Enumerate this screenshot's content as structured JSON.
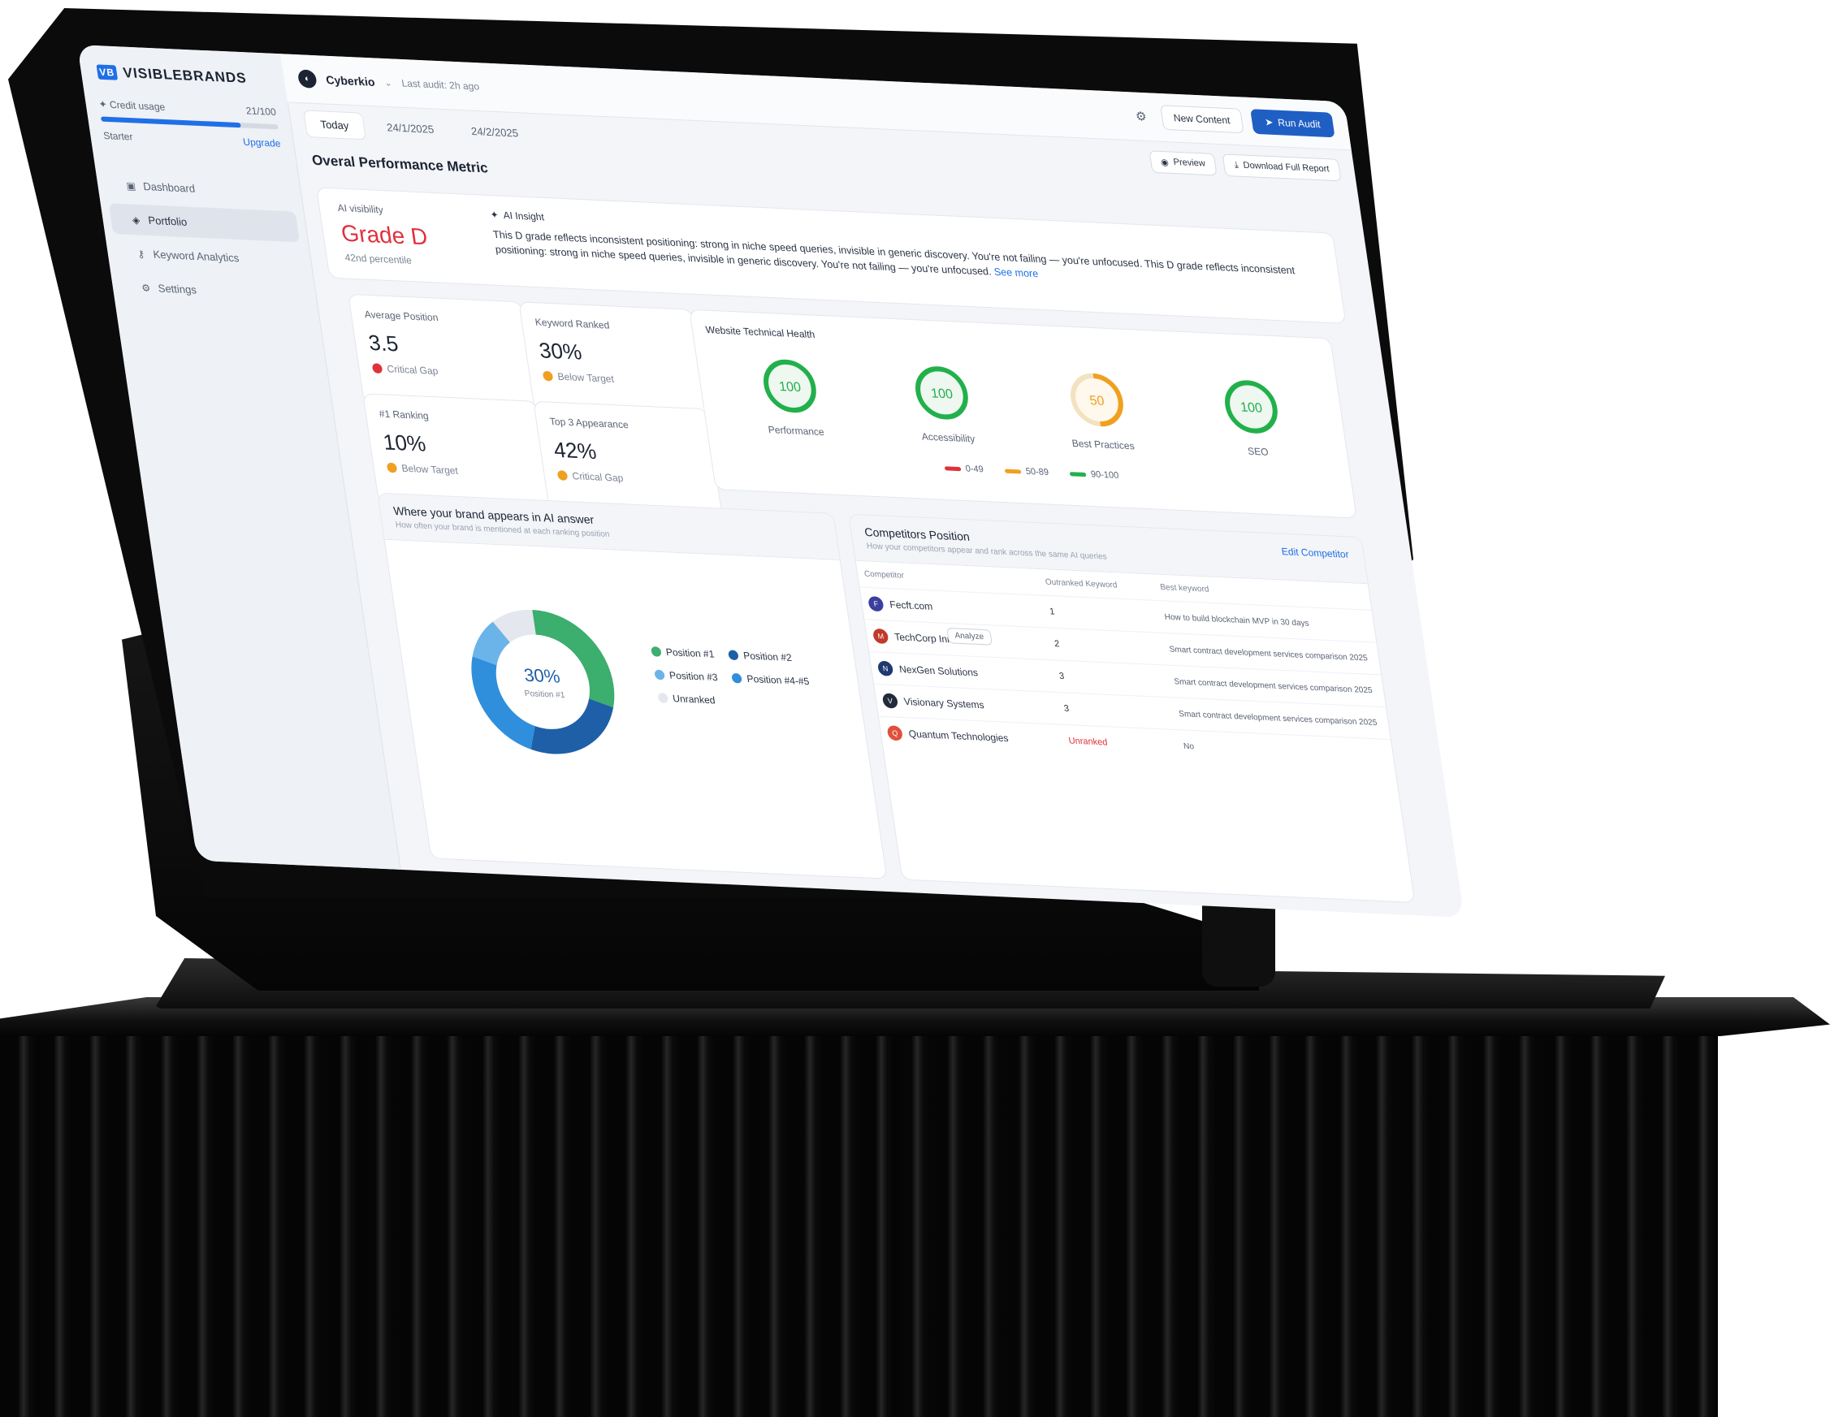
{
  "app": {
    "logo_text": "VISIBLEBRANDS",
    "logo_mark": "VB"
  },
  "sidebar": {
    "credit_label": "Credit usage",
    "credit_value": "21/100",
    "credit_fraction": 0.79,
    "plan": "Starter",
    "upgrade_label": "Upgrade",
    "items": [
      {
        "label": "Dashboard",
        "icon": "dashboard-icon",
        "active": false
      },
      {
        "label": "Portfolio",
        "icon": "portfolio-icon",
        "active": true
      },
      {
        "label": "Keyword Analytics",
        "icon": "key-icon",
        "active": false
      },
      {
        "label": "Settings",
        "icon": "gear-icon",
        "active": false
      }
    ]
  },
  "topbar": {
    "brand_name": "Cyberkio",
    "last_audit": "Last audit: 2h ago",
    "new_content_label": "New Content",
    "run_audit_label": "Run Audit"
  },
  "datebar": {
    "tabs": [
      "Today",
      "24/1/2025",
      "24/2/2025"
    ],
    "active_tab": "Today",
    "preview_label": "Preview",
    "download_label": "Download Full Report"
  },
  "main": {
    "section_title": "Overal Performance Metric",
    "ai_visibility": {
      "label": "AI visibility",
      "grade": "Grade D",
      "percentile": "42nd percentile"
    },
    "ai_insight": {
      "label": "AI Insight",
      "text": "This D grade reflects inconsistent positioning: strong in niche speed queries, invisible in generic discovery. You're not failing — you're unfocused. This D grade reflects inconsistent positioning: strong in niche speed queries, invisible in generic discovery. You're not failing — you're unfocused.",
      "see_more": "See more"
    },
    "metrics": [
      {
        "label": "Average Position",
        "value": "3.5",
        "status": "Critical Gap",
        "status_color": "#e0313b"
      },
      {
        "label": "Keyword Ranked",
        "value": "30%",
        "status": "Below Target",
        "status_color": "#f0a020"
      },
      {
        "label": "#1 Ranking",
        "value": "10%",
        "status": "Below Target",
        "status_color": "#f0a020"
      },
      {
        "label": "Top 3 Appearance",
        "value": "42%",
        "status": "Critical Gap",
        "status_color": "#f0a020"
      }
    ],
    "technical_health": {
      "title": "Website Technical Health",
      "gauges": [
        {
          "label": "Performance",
          "value": "100",
          "color": "#22b04b"
        },
        {
          "label": "Accessibility",
          "value": "100",
          "color": "#22b04b"
        },
        {
          "label": "Best Practices",
          "value": "50",
          "color": "#f0a020"
        },
        {
          "label": "SEO",
          "value": "100",
          "color": "#22b04b"
        }
      ],
      "legend": [
        {
          "label": "0-49",
          "color": "#e0313b"
        },
        {
          "label": "50-89",
          "color": "#f0a020"
        },
        {
          "label": "90-100",
          "color": "#22b04b"
        }
      ]
    },
    "brand_appearance": {
      "title": "Where your brand appears in AI answer",
      "subtitle": "How often your brand is mentioned at each ranking position",
      "center_value": "30%",
      "center_label": "Position #1",
      "legend": [
        {
          "label": "Position #1",
          "color": "#3cae6e"
        },
        {
          "label": "Position #2",
          "color": "#1f5fa8"
        },
        {
          "label": "Position #3",
          "color": "#6bb4ea"
        },
        {
          "label": "Position #4-#5",
          "color": "#2f8fdc"
        },
        {
          "label": "Unranked",
          "color": "#e4e8ee"
        }
      ]
    },
    "competitors": {
      "title": "Competitors Position",
      "subtitle": "How your competitors appear and rank across the same AI queries",
      "edit_label": "Edit Competitor",
      "tooltip": "Analyze",
      "headers": [
        "Competitor",
        "Outranked Keyword",
        "Best keyword"
      ],
      "rows": [
        {
          "name": "Fecft.com",
          "logo_color": "#3a3fa0",
          "outranked": "1",
          "best": "How to build blockchain MVP in 30 days",
          "unranked": false
        },
        {
          "name": "TechCorp Innovations",
          "logo_color": "#c0392b",
          "outranked": "2",
          "best": "Smart contract development services comparison 2025",
          "unranked": false
        },
        {
          "name": "NexGen Solutions",
          "logo_color": "#1f3a70",
          "outranked": "3",
          "best": "Smart contract development services comparison 2025",
          "unranked": false
        },
        {
          "name": "Visionary Systems",
          "logo_color": "#232b3a",
          "outranked": "3",
          "best": "Smart contract development services comparison 2025",
          "unranked": false
        },
        {
          "name": "Quantum Technologies",
          "logo_color": "#e0503b",
          "outranked": "Unranked",
          "best": "No",
          "unranked": true
        }
      ]
    }
  }
}
